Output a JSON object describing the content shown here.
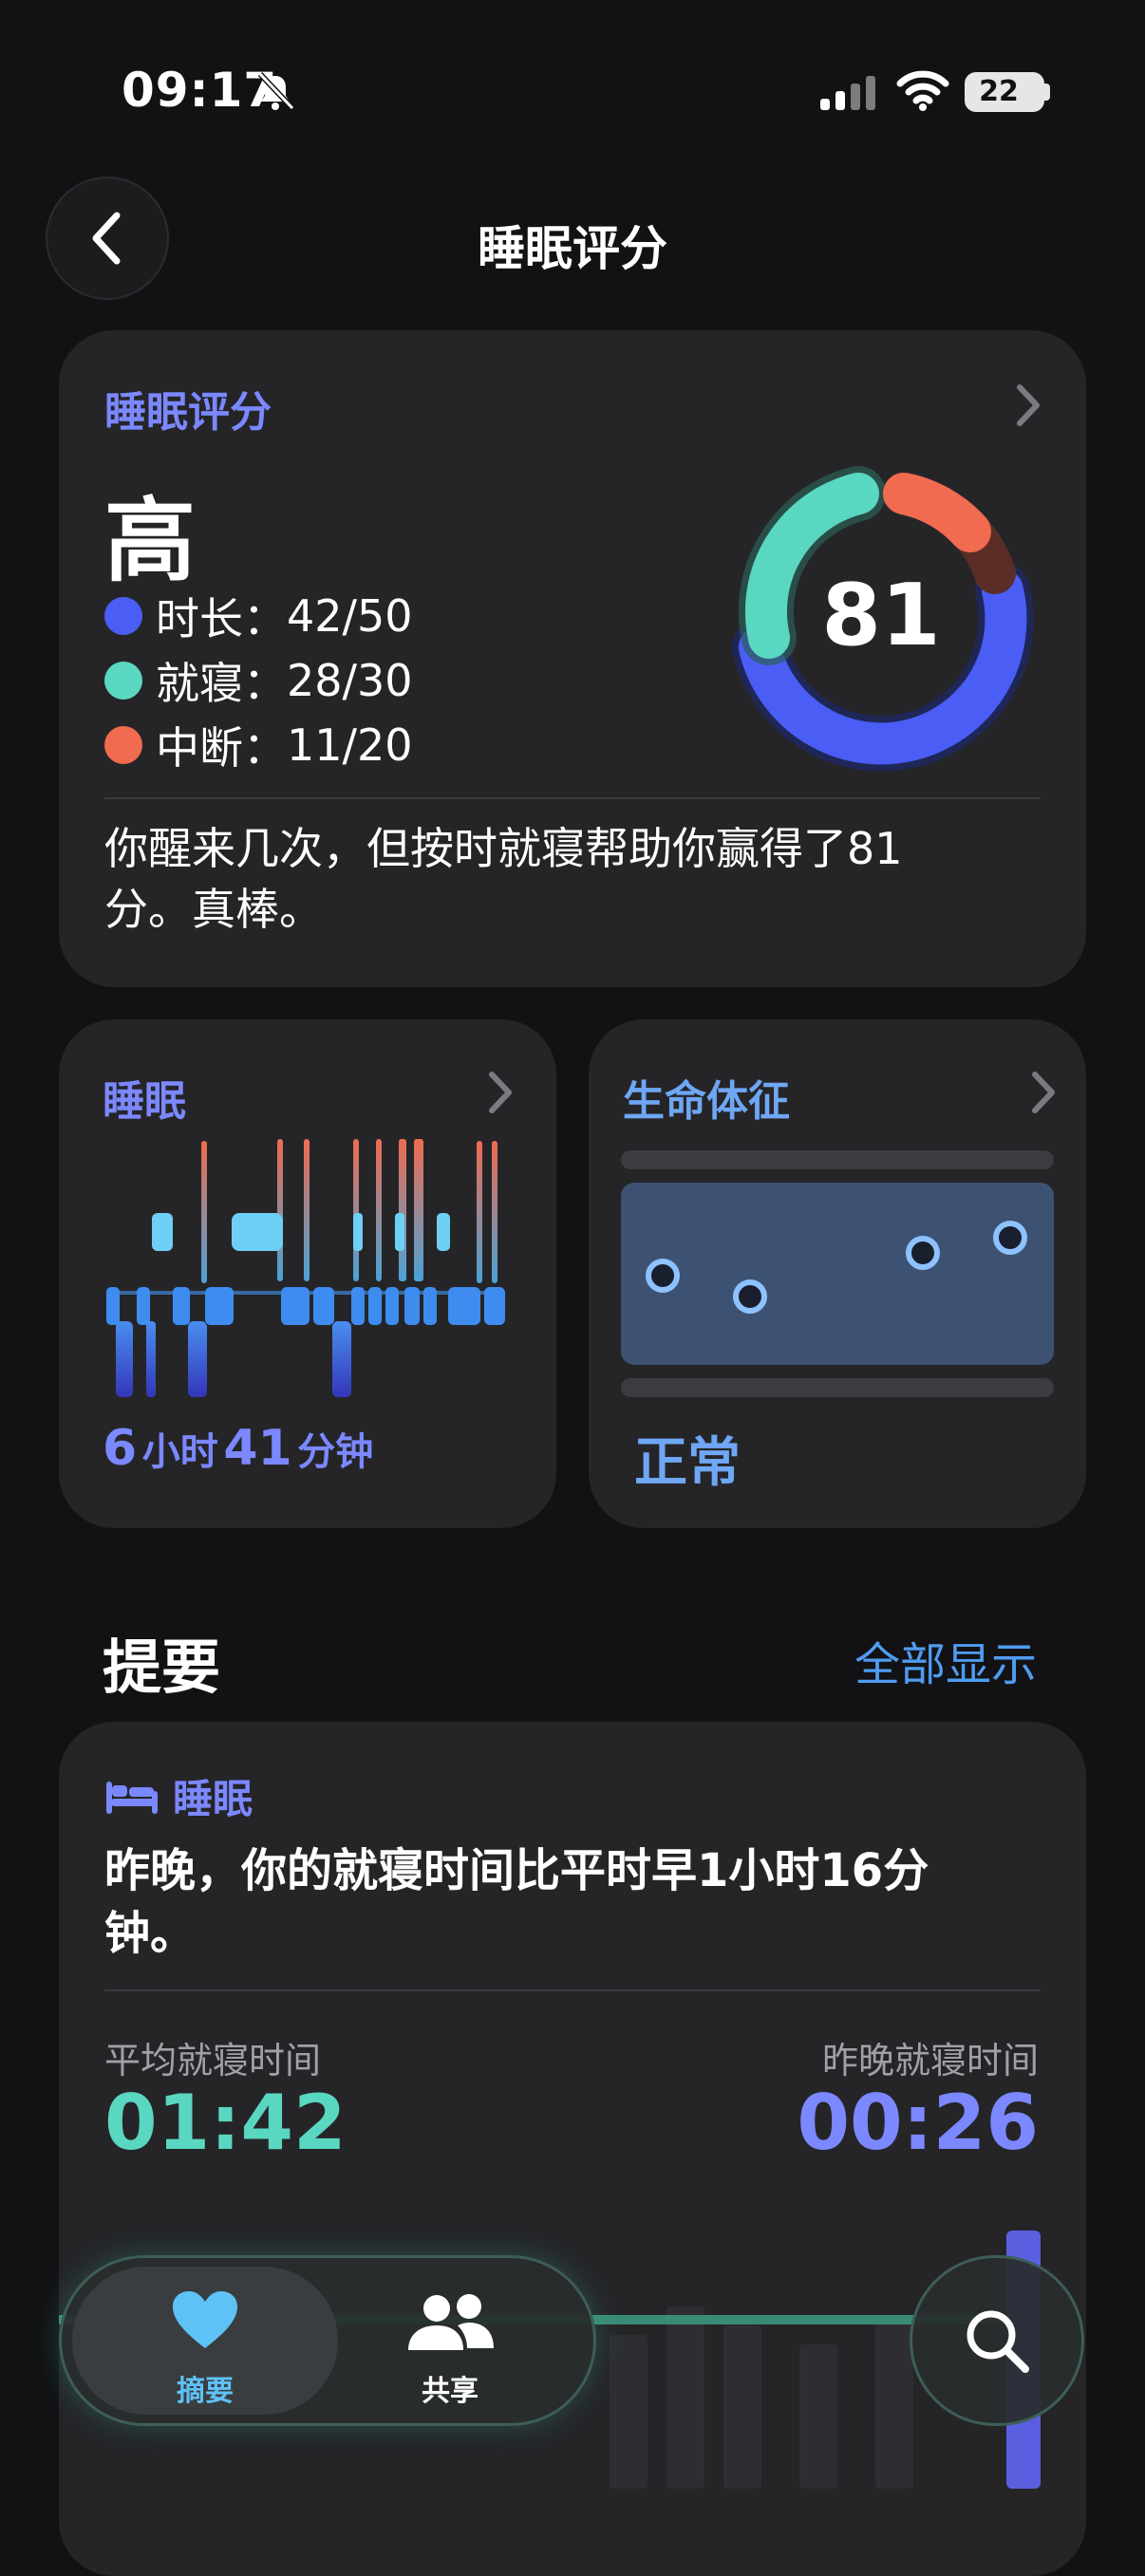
{
  "status_bar": {
    "time": "09:17",
    "battery": "22"
  },
  "nav": {
    "title": "睡眠评分"
  },
  "score_card": {
    "label": "睡眠评分",
    "grade": "高",
    "score": "81",
    "metrics": [
      {
        "name": "时长",
        "value": "42/50",
        "color": "#4a5df5"
      },
      {
        "name": "就寝",
        "value": "28/30",
        "color": "#5ad7c0"
      },
      {
        "name": "中断",
        "value": "11/20",
        "color": "#f06b50"
      }
    ],
    "summary": "你醒来几次，但按时就寝帮助你赢得了81分。真棒。"
  },
  "sleep_card": {
    "label": "睡眠",
    "hours": "6",
    "hours_unit": "小时",
    "minutes": "41",
    "minutes_unit": "分钟"
  },
  "vitals_card": {
    "label": "生命体征",
    "status": "正常"
  },
  "highlights": {
    "title": "提要",
    "show_all": "全部显示",
    "tag": "睡眠",
    "text": "昨晚，你的就寝时间比平时早1小时16分钟。",
    "avg_label": "平均就寝时间",
    "avg_value": "01:42",
    "last_label": "昨晚就寝时间",
    "last_value": "00:26"
  },
  "tabbar": {
    "tabs": [
      {
        "label": "摘要"
      },
      {
        "label": "共享"
      }
    ]
  },
  "colors": {
    "accent_purple": "#7b88ff",
    "teal": "#5ad7c0",
    "blue": "#4a5df5",
    "coral": "#f06b50",
    "link_blue": "#4f9cf2"
  },
  "icons": [
    "bell-slash-icon",
    "cellular-signal-icon",
    "wifi-icon",
    "chevron-left-icon",
    "chevron-right-icon",
    "bed-icon",
    "heart-icon",
    "people-icon",
    "search-icon"
  ]
}
